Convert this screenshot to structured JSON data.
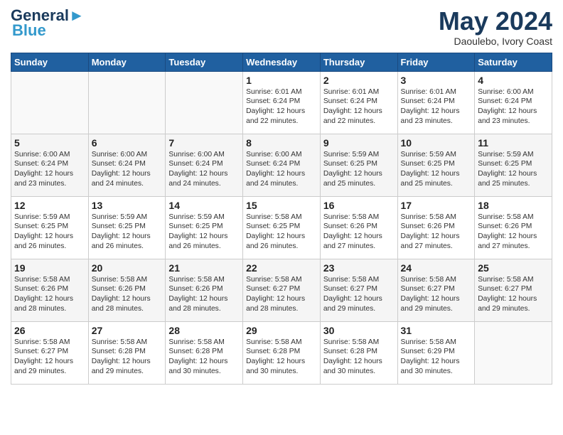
{
  "header": {
    "logo_line1": "General",
    "logo_line2": "Blue",
    "month": "May 2024",
    "location": "Daoulebo, Ivory Coast"
  },
  "days_of_week": [
    "Sunday",
    "Monday",
    "Tuesday",
    "Wednesday",
    "Thursday",
    "Friday",
    "Saturday"
  ],
  "weeks": [
    [
      {
        "day": "",
        "text": ""
      },
      {
        "day": "",
        "text": ""
      },
      {
        "day": "",
        "text": ""
      },
      {
        "day": "1",
        "text": "Sunrise: 6:01 AM\nSunset: 6:24 PM\nDaylight: 12 hours\nand 22 minutes."
      },
      {
        "day": "2",
        "text": "Sunrise: 6:01 AM\nSunset: 6:24 PM\nDaylight: 12 hours\nand 22 minutes."
      },
      {
        "day": "3",
        "text": "Sunrise: 6:01 AM\nSunset: 6:24 PM\nDaylight: 12 hours\nand 23 minutes."
      },
      {
        "day": "4",
        "text": "Sunrise: 6:00 AM\nSunset: 6:24 PM\nDaylight: 12 hours\nand 23 minutes."
      }
    ],
    [
      {
        "day": "5",
        "text": "Sunrise: 6:00 AM\nSunset: 6:24 PM\nDaylight: 12 hours\nand 23 minutes."
      },
      {
        "day": "6",
        "text": "Sunrise: 6:00 AM\nSunset: 6:24 PM\nDaylight: 12 hours\nand 24 minutes."
      },
      {
        "day": "7",
        "text": "Sunrise: 6:00 AM\nSunset: 6:24 PM\nDaylight: 12 hours\nand 24 minutes."
      },
      {
        "day": "8",
        "text": "Sunrise: 6:00 AM\nSunset: 6:24 PM\nDaylight: 12 hours\nand 24 minutes."
      },
      {
        "day": "9",
        "text": "Sunrise: 5:59 AM\nSunset: 6:25 PM\nDaylight: 12 hours\nand 25 minutes."
      },
      {
        "day": "10",
        "text": "Sunrise: 5:59 AM\nSunset: 6:25 PM\nDaylight: 12 hours\nand 25 minutes."
      },
      {
        "day": "11",
        "text": "Sunrise: 5:59 AM\nSunset: 6:25 PM\nDaylight: 12 hours\nand 25 minutes."
      }
    ],
    [
      {
        "day": "12",
        "text": "Sunrise: 5:59 AM\nSunset: 6:25 PM\nDaylight: 12 hours\nand 26 minutes."
      },
      {
        "day": "13",
        "text": "Sunrise: 5:59 AM\nSunset: 6:25 PM\nDaylight: 12 hours\nand 26 minutes."
      },
      {
        "day": "14",
        "text": "Sunrise: 5:59 AM\nSunset: 6:25 PM\nDaylight: 12 hours\nand 26 minutes."
      },
      {
        "day": "15",
        "text": "Sunrise: 5:58 AM\nSunset: 6:25 PM\nDaylight: 12 hours\nand 26 minutes."
      },
      {
        "day": "16",
        "text": "Sunrise: 5:58 AM\nSunset: 6:26 PM\nDaylight: 12 hours\nand 27 minutes."
      },
      {
        "day": "17",
        "text": "Sunrise: 5:58 AM\nSunset: 6:26 PM\nDaylight: 12 hours\nand 27 minutes."
      },
      {
        "day": "18",
        "text": "Sunrise: 5:58 AM\nSunset: 6:26 PM\nDaylight: 12 hours\nand 27 minutes."
      }
    ],
    [
      {
        "day": "19",
        "text": "Sunrise: 5:58 AM\nSunset: 6:26 PM\nDaylight: 12 hours\nand 28 minutes."
      },
      {
        "day": "20",
        "text": "Sunrise: 5:58 AM\nSunset: 6:26 PM\nDaylight: 12 hours\nand 28 minutes."
      },
      {
        "day": "21",
        "text": "Sunrise: 5:58 AM\nSunset: 6:26 PM\nDaylight: 12 hours\nand 28 minutes."
      },
      {
        "day": "22",
        "text": "Sunrise: 5:58 AM\nSunset: 6:27 PM\nDaylight: 12 hours\nand 28 minutes."
      },
      {
        "day": "23",
        "text": "Sunrise: 5:58 AM\nSunset: 6:27 PM\nDaylight: 12 hours\nand 29 minutes."
      },
      {
        "day": "24",
        "text": "Sunrise: 5:58 AM\nSunset: 6:27 PM\nDaylight: 12 hours\nand 29 minutes."
      },
      {
        "day": "25",
        "text": "Sunrise: 5:58 AM\nSunset: 6:27 PM\nDaylight: 12 hours\nand 29 minutes."
      }
    ],
    [
      {
        "day": "26",
        "text": "Sunrise: 5:58 AM\nSunset: 6:27 PM\nDaylight: 12 hours\nand 29 minutes."
      },
      {
        "day": "27",
        "text": "Sunrise: 5:58 AM\nSunset: 6:28 PM\nDaylight: 12 hours\nand 29 minutes."
      },
      {
        "day": "28",
        "text": "Sunrise: 5:58 AM\nSunset: 6:28 PM\nDaylight: 12 hours\nand 30 minutes."
      },
      {
        "day": "29",
        "text": "Sunrise: 5:58 AM\nSunset: 6:28 PM\nDaylight: 12 hours\nand 30 minutes."
      },
      {
        "day": "30",
        "text": "Sunrise: 5:58 AM\nSunset: 6:28 PM\nDaylight: 12 hours\nand 30 minutes."
      },
      {
        "day": "31",
        "text": "Sunrise: 5:58 AM\nSunset: 6:29 PM\nDaylight: 12 hours\nand 30 minutes."
      },
      {
        "day": "",
        "text": ""
      }
    ]
  ]
}
